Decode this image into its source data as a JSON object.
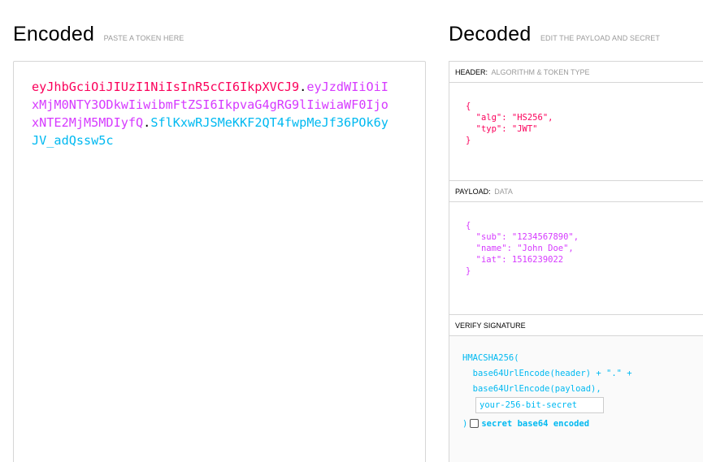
{
  "encoded": {
    "title": "Encoded",
    "subtitle": "PASTE A TOKEN HERE",
    "token": {
      "header": "eyJhbGciOiJIUzI1NiIsInR5cCI6IkpXVCJ9",
      "dot1": ".",
      "payload": "eyJzdWIiOiIxMjM0NTY3ODkwIiwibmFtZSI6IkpvaG4gRG9lIiwiaWF0IjoxNTE2MjM5MDIyfQ",
      "dot2": ".",
      "signature": "SflKxwRJSMeKKF2QT4fwpMeJf36POk6yJV_adQssw5c"
    }
  },
  "decoded": {
    "title": "Decoded",
    "subtitle": "EDIT THE PAYLOAD AND SECRET",
    "header_section": {
      "label": "HEADER:",
      "hint": "ALGORITHM & TOKEN TYPE",
      "json": "{\n  \"alg\": \"HS256\",\n  \"typ\": \"JWT\"\n}"
    },
    "payload_section": {
      "label": "PAYLOAD:",
      "hint": "DATA",
      "json": "{\n  \"sub\": \"1234567890\",\n  \"name\": \"John Doe\",\n  \"iat\": 1516239022\n}"
    },
    "verify_section": {
      "label": "VERIFY SIGNATURE",
      "fn_open": "HMACSHA256(",
      "line_header": "  base64UrlEncode(header) + \".\" +",
      "line_payload": "  base64UrlEncode(payload),",
      "secret_value": "your-256-bit-secret",
      "close_paren": ")",
      "checkbox_label": "secret base64 encoded"
    }
  },
  "colors": {
    "header": "#fb015b",
    "payload": "#d63aff",
    "signature": "#00b9f1",
    "border": "#d6d6d6",
    "muted": "#9a9a9a"
  }
}
